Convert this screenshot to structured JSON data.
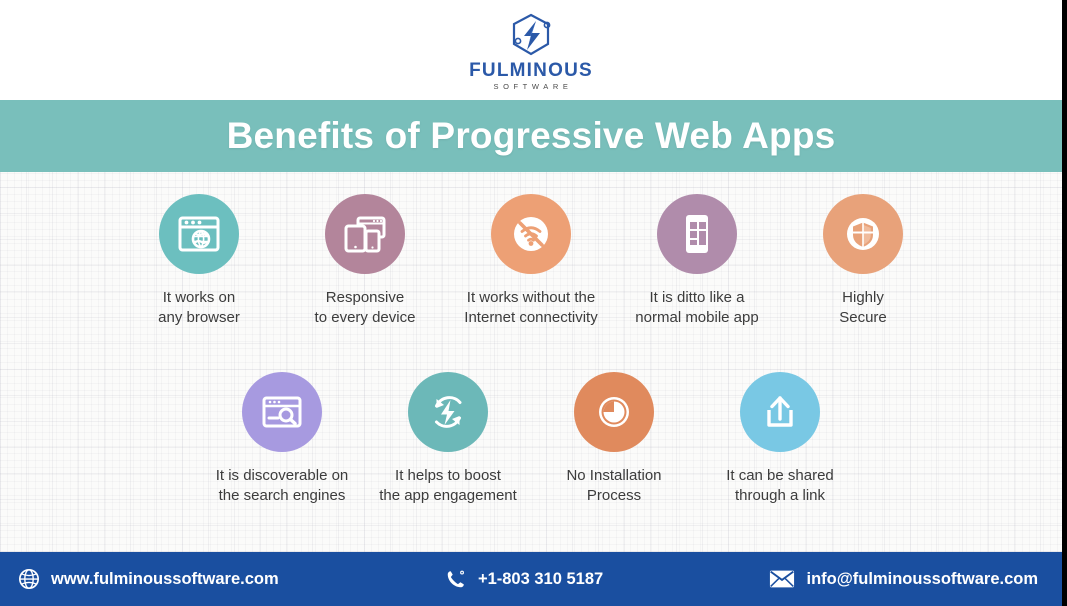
{
  "brand": {
    "logo_icon": "fulminous-hex-bolt-logo",
    "name": "FULMINOUS",
    "tagline": "SOFTWARE",
    "logo_color": "#2b59a8"
  },
  "header": {
    "title": "Benefits of Progressive Web Apps",
    "band_color": "#79bfbb",
    "title_color": "#ffffff"
  },
  "benefits": {
    "row1": [
      {
        "label": "It works on\nany browser",
        "icon": "browser-globe-icon",
        "color": "#6cbfbf"
      },
      {
        "label": "Responsive\nto every device",
        "icon": "responsive-devices-icon",
        "color": "#b3859b"
      },
      {
        "label": "It works without the\nInternet connectivity",
        "icon": "no-wifi-icon",
        "color": "#eda075"
      },
      {
        "label": "It is ditto like a\nnormal mobile app",
        "icon": "mobile-app-grid-icon",
        "color": "#b08cab"
      },
      {
        "label": "Highly\nSecure",
        "icon": "shield-secure-icon",
        "color": "#e8a27a"
      }
    ],
    "row2": [
      {
        "label": "It is discoverable on\nthe search engines",
        "icon": "browser-search-icon",
        "color": "#a79ae0"
      },
      {
        "label": "It helps to boost\nthe app engagement",
        "icon": "refresh-bolt-icon",
        "color": "#6cb8b8"
      },
      {
        "label": "No Installation\nProcess",
        "icon": "pie-clock-icon",
        "color": "#e08a5d"
      },
      {
        "label": "It can be shared\nthrough a link",
        "icon": "share-upload-icon",
        "color": "#79c8e4"
      }
    ]
  },
  "footer": {
    "background": "#1a4fa0",
    "website": "www.fulminoussoftware.com",
    "website_icon": "globe-icon",
    "phone": "+1-803 310 5187",
    "phone_icon": "phone-icon",
    "email": "info@fulminoussoftware.com",
    "email_icon": "envelope-icon"
  }
}
